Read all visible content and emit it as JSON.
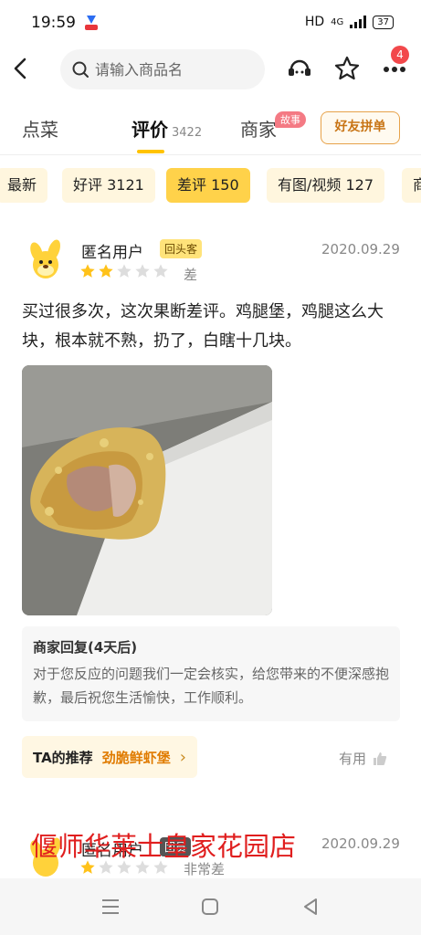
{
  "status": {
    "time": "19:59",
    "hd": "HD",
    "network": "4G",
    "battery": "37"
  },
  "nav": {
    "search_placeholder": "请输入商品名",
    "badge_count": "4",
    "icons": [
      "back-arrow-icon",
      "search-icon",
      "customer-service-icon",
      "star-icon",
      "more-icon"
    ]
  },
  "tabs": {
    "order_label": "点菜",
    "reviews_label": "评价",
    "reviews_count": "3422",
    "merchant_label": "商家",
    "story_tag": "故事",
    "group_order_button": "好友拼单"
  },
  "filters": [
    {
      "label": "最新",
      "selected": false
    },
    {
      "label": "好评 3121",
      "selected": false
    },
    {
      "label": "差评 150",
      "selected": true
    },
    {
      "label": "有图/视频 127",
      "selected": false
    },
    {
      "label": "商",
      "selected": false
    }
  ],
  "review": {
    "user": "匿名用户",
    "tag": "回头客",
    "date": "2020.09.29",
    "stars": 2,
    "rating_label": "差",
    "text": "买过很多次，这次果断差评。鸡腿堡，鸡腿这么大块，根本就不熟，扔了，白瞎十几块。",
    "reply_title": "商家回复(4天后)",
    "reply_text": "对于您反应的问题我们一定会核实，给您带来的不便深感抱歉，最后祝您生活愉快，工作顺利。",
    "rec_label": "TA的推荐",
    "rec_dish": "劲脆鲜虾堡",
    "useful_label": "有用"
  },
  "review2": {
    "user": "匿名用户",
    "tag": "团员",
    "date": "2020.09.29",
    "stars": 1,
    "rating_label": "非常差"
  },
  "watermark": "偃师华莱士皇家花园店",
  "colors": {
    "accent": "#ffd24a",
    "chip_bg": "#fff6de",
    "badge": "#f2484b",
    "watermark": "#e01e1e",
    "orange": "#e07b00"
  }
}
